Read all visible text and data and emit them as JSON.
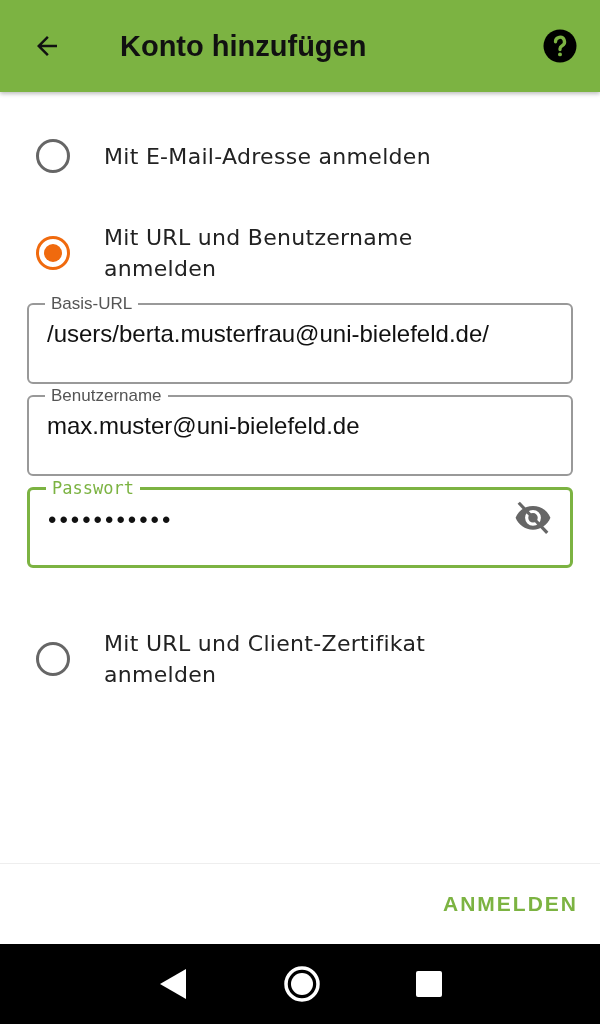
{
  "app_bar": {
    "title": "Konto hinzufügen"
  },
  "options": [
    {
      "label": "Mit E-Mail-Adresse anmelden",
      "selected": false
    },
    {
      "label": "Mit URL und Benutzername anmelden",
      "selected": true,
      "fields": [
        {
          "label": "Basis-URL",
          "value": "/users/berta.musterfrau@uni-bielefeld.de/",
          "focused": false,
          "kind": "text"
        },
        {
          "label": "Benutzername",
          "value": "max.muster@uni-bielefeld.de",
          "focused": false,
          "kind": "text"
        },
        {
          "label": "Passwort",
          "value": "•••••••••••",
          "focused": true,
          "kind": "password"
        }
      ]
    },
    {
      "label": "Mit URL und Client-Zertifikat anmelden",
      "selected": false
    }
  ],
  "action_button": "ANMELDEN"
}
